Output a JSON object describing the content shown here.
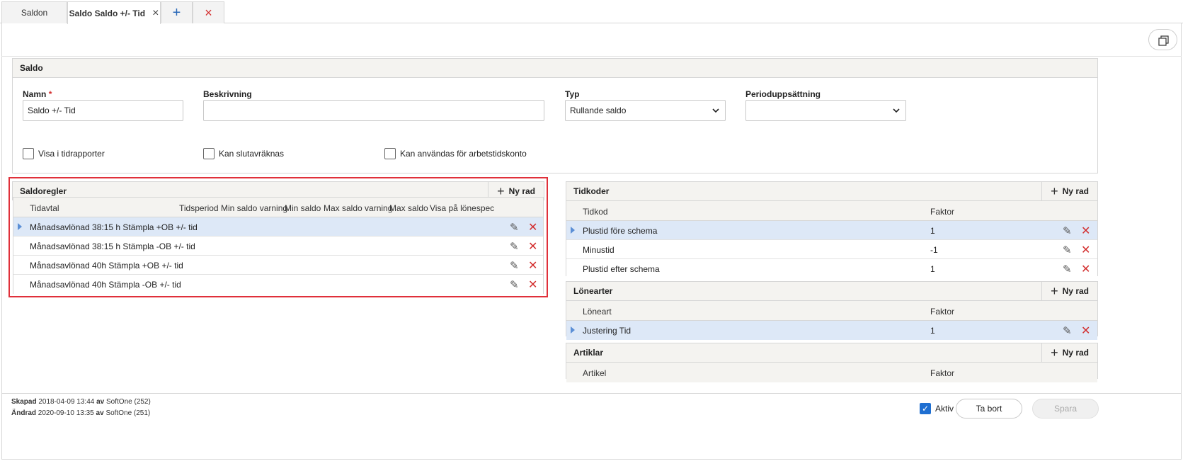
{
  "tabs": [
    {
      "label": "Saldon"
    },
    {
      "label": "Saldo Saldo +/- Tid",
      "close": "×"
    },
    {
      "label": "+"
    },
    {
      "label": "×"
    }
  ],
  "saldo_panel": {
    "title": "Saldo",
    "namn_label": "Namn",
    "namn_required": "*",
    "namn_value": "Saldo +/- Tid",
    "beskrivning_label": "Beskrivning",
    "beskrivning_value": "",
    "typ_label": "Typ",
    "typ_value": "Rullande saldo",
    "period_label": "Perioduppsättning",
    "period_value": "",
    "checkboxes": [
      {
        "label": "Visa i tidrapporter",
        "checked": false
      },
      {
        "label": "Kan slutavräknas",
        "checked": false
      },
      {
        "label": "Kan användas för arbetstidskonto",
        "checked": false
      }
    ]
  },
  "saldoregler": {
    "title": "Saldoregler",
    "new_row": "Ny rad",
    "columns": [
      "Tidavtal",
      "Tidsperiod",
      "Min saldo varning",
      "Min saldo",
      "Max saldo varning",
      "Max saldo",
      "Visa på lönespec"
    ],
    "rows": [
      "Månadsavlönad 38:15 h Stämpla +OB +/- tid",
      "Månadsavlönad 38:15 h Stämpla -OB +/- tid",
      "Månadsavlönad 40h Stämpla +OB +/- tid",
      "Månadsavlönad 40h Stämpla -OB +/- tid"
    ]
  },
  "tidkoder": {
    "title": "Tidkoder",
    "new_row": "Ny rad",
    "columns": [
      "Tidkod",
      "Faktor"
    ],
    "rows": [
      {
        "name": "Plustid före schema",
        "faktor": "1"
      },
      {
        "name": "Minustid",
        "faktor": "-1"
      },
      {
        "name": "Plustid efter schema",
        "faktor": "1"
      }
    ]
  },
  "lonearter": {
    "title": "Lönearter",
    "new_row": "Ny rad",
    "columns": [
      "Löneart",
      "Faktor"
    ],
    "rows": [
      {
        "name": "Justering Tid",
        "faktor": "1"
      }
    ]
  },
  "artiklar": {
    "title": "Artiklar",
    "new_row": "Ny rad",
    "columns": [
      "Artikel",
      "Faktor"
    ]
  },
  "footer": {
    "skapad_label": "Skapad",
    "skapad_value": "2018-04-09 13:44",
    "skapad_av": "av",
    "skapad_user": "SoftOne (252)",
    "andrad_label": "Ändrad",
    "andrad_value": "2020-09-10 13:35",
    "andrad_av": "av",
    "andrad_user": "SoftOne (251)",
    "aktiv_label": "Aktiv",
    "ta_bort": "Ta bort",
    "spara": "Spara"
  },
  "icons": {
    "edit": "pencil-icon",
    "delete": "close-icon",
    "expand": "triangle-right-icon",
    "copy": "copy-icon"
  }
}
